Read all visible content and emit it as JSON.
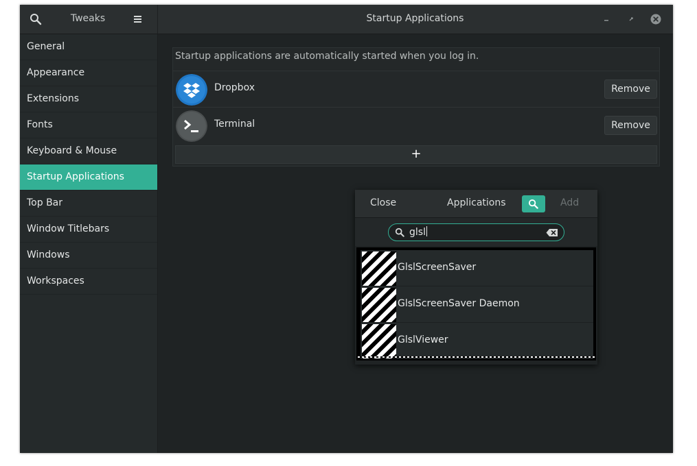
{
  "window": {
    "sidebar_header_title": "Tweaks",
    "title": "Startup Applications"
  },
  "sidebar": {
    "items": [
      {
        "label": "General"
      },
      {
        "label": "Appearance"
      },
      {
        "label": "Extensions"
      },
      {
        "label": "Fonts"
      },
      {
        "label": "Keyboard & Mouse"
      },
      {
        "label": "Startup Applications",
        "active": true
      },
      {
        "label": "Top Bar"
      },
      {
        "label": "Window Titlebars"
      },
      {
        "label": "Windows"
      },
      {
        "label": "Workspaces"
      }
    ]
  },
  "main": {
    "description": "Startup applications are automatically started when you log in.",
    "apps": [
      {
        "name": "Dropbox",
        "icon": "dropbox-icon",
        "remove_label": "Remove"
      },
      {
        "name": "Terminal",
        "icon": "terminal-icon",
        "remove_label": "Remove"
      }
    ],
    "add_label": "+"
  },
  "dialog": {
    "close_label": "Close",
    "title": "Applications",
    "add_label": "Add",
    "search_value": "glsl",
    "results": [
      {
        "name": "GlslScreenSaver"
      },
      {
        "name": "GlslScreenSaver Daemon"
      },
      {
        "name": "GlslViewer"
      }
    ]
  },
  "colors": {
    "accent": "#33b095",
    "window_bg": "#1f2324",
    "sidebar_bg": "#252a2b",
    "headerbar_bg": "#2b2f30"
  }
}
